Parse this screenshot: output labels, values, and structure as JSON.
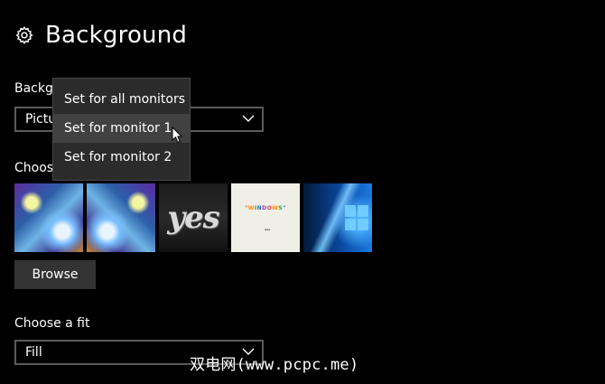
{
  "page": {
    "title": "Background"
  },
  "background_section": {
    "label": "Backgr",
    "dropdown_value": "Pictu"
  },
  "choose_picture": {
    "label": "Choos",
    "thumbnails": [
      {
        "name": "anime-art-1"
      },
      {
        "name": "anime-art-2"
      },
      {
        "name": "yes-logo",
        "text": "yes"
      },
      {
        "name": "windows-text",
        "text": "\"WINDOWS\""
      },
      {
        "name": "windows-10-hero"
      }
    ],
    "browse_label": "Browse"
  },
  "fit": {
    "label": "Choose a fit",
    "value": "Fill"
  },
  "context_menu": {
    "items": [
      {
        "label": "Set for all monitors"
      },
      {
        "label": "Set for monitor 1"
      },
      {
        "label": "Set for monitor 2"
      }
    ],
    "hovered_index": 1
  },
  "watermark": "双电网(www.pcpc.me)",
  "colors": {
    "background": "#000000",
    "menu_bg": "#2b2b2b",
    "menu_hover": "#414141",
    "button_bg": "#333333",
    "border": "#5a5a5a"
  }
}
